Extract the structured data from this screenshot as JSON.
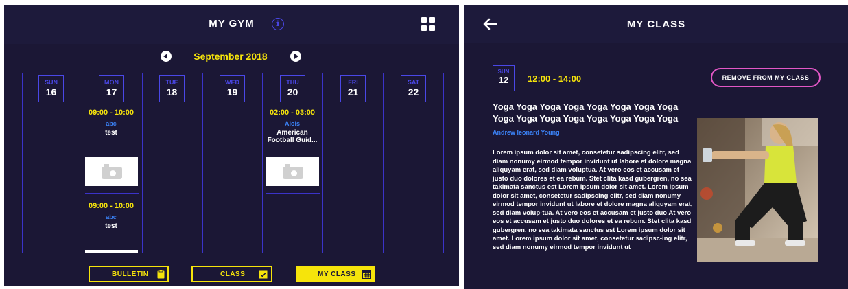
{
  "left_screen": {
    "title": "MY GYM",
    "info_icon": "i",
    "month": "September 2018",
    "days": [
      {
        "name": "SUN",
        "num": "16"
      },
      {
        "name": "MON",
        "num": "17"
      },
      {
        "name": "TUE",
        "num": "18"
      },
      {
        "name": "WED",
        "num": "19"
      },
      {
        "name": "THU",
        "num": "20"
      },
      {
        "name": "FRI",
        "num": "21"
      },
      {
        "name": "SAT",
        "num": "22"
      }
    ],
    "events": [
      {
        "day": "MON",
        "time": "09:00 - 10:00",
        "teacher": "abc",
        "title": "test"
      },
      {
        "day": "MON",
        "time": "09:00 - 10:00",
        "teacher": "abc",
        "title": "test"
      },
      {
        "day": "THU",
        "time": "02:00 - 03:00",
        "teacher": "Alois",
        "title": "American Football Guid..."
      }
    ],
    "tabs": [
      {
        "label": "BULLETIN",
        "icon": "clipboard-icon",
        "active": false
      },
      {
        "label": "CLASS",
        "icon": "calendar-check-icon",
        "active": false
      },
      {
        "label": "MY CLASS",
        "icon": "calendar-grid-icon",
        "active": true
      }
    ]
  },
  "right_screen": {
    "title": "MY CLASS",
    "day_name": "SUN",
    "day_num": "12",
    "time": "12:00 - 14:00",
    "remove_button": "REMOVE FROM MY CLASS",
    "class_title": "Yoga Yoga Yoga Yoga Yoga Yoga Yoga Yoga Yoga Yoga Yoga Yoga Yoga Yoga Yoga Yoga",
    "teacher": "Andrew leonard Young",
    "description": "Lorem ipsum dolor sit amet, consetetur sadipscing elitr, sed diam nonumy eirmod tempor invidunt ut labore et dolore magna aliquyam erat, sed diam voluptua. At vero eos et accusam et justo duo dolores et ea rebum. Stet clita kasd gubergren, no sea takimata sanctus est Lorem ipsum dolor sit amet. Lorem ipsum dolor sit amet, consetetur sadipscing elitr, sed diam nonumy eirmod tempor invidunt ut labore et dolore magna aliquyam erat, sed diam volup-tua. At vero eos et accusam et justo duo At vero eos et accusam et justo duo dolores et ea rebum. Stet clita kasd gubergren, no sea takimata sanctus est Lorem ipsum dolor sit amet. Lorem ipsum dolor sit amet, consetetur sadipsc-ing elitr, sed diam nonumy eirmod tempor invidunt ut"
  },
  "colors": {
    "background": "#1b1735",
    "header": "#1d1a3b",
    "accent_yellow": "#f6e40b",
    "accent_blue": "#4a47e6",
    "teacher_blue": "#3b82f6",
    "remove_border": "#e357c6"
  }
}
